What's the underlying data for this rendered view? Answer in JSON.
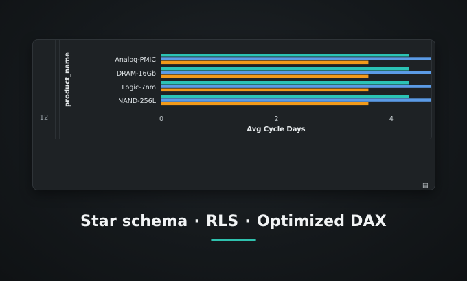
{
  "table": {
    "row_number": "12"
  },
  "chart_data": {
    "type": "bar",
    "orientation": "horizontal",
    "categories": [
      "Analog-PMIC",
      "DRAM-16Gb",
      "Logic-7nm",
      "NAND-256L"
    ],
    "series": [
      {
        "color": "#2bc3b5",
        "values": [
          4.3,
          4.3,
          4.3,
          4.3
        ]
      },
      {
        "color": "#5b9be6",
        "values": [
          5.0,
          5.0,
          5.0,
          5.0
        ]
      },
      {
        "color": "#f29a1a",
        "values": [
          3.6,
          3.6,
          3.6,
          3.6
        ]
      }
    ],
    "xlabel": "Avg Cycle Days",
    "ylabel": "product_name",
    "xlim": [
      0,
      5.1
    ],
    "xticks": [
      "0",
      "2",
      "4"
    ],
    "grid": false
  },
  "caption": {
    "part1": "Star schema",
    "part2": "RLS",
    "part3": "Optimized DAX",
    "separator": "·"
  },
  "colors": {
    "accent": "#2fc1ae"
  }
}
